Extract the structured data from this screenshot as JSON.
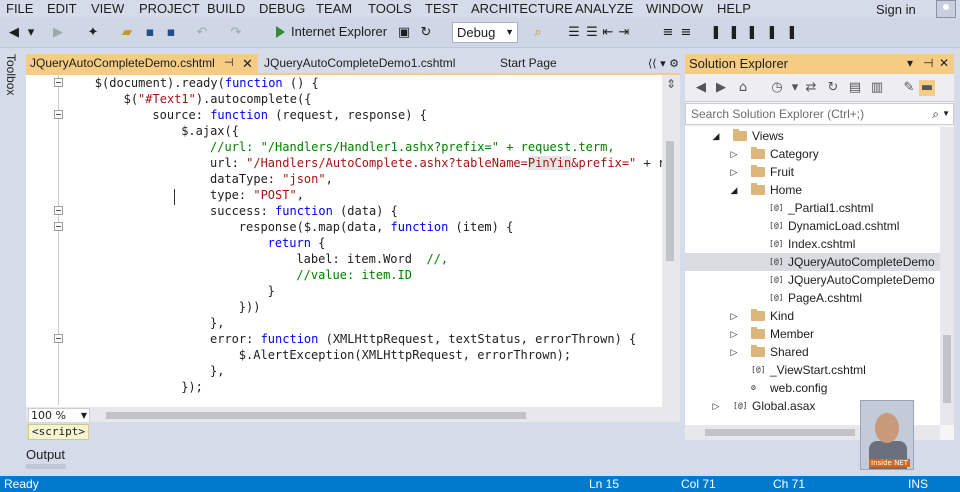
{
  "menu": [
    "FILE",
    "EDIT",
    "VIEW",
    "PROJECT",
    "BUILD",
    "DEBUG",
    "TEAM",
    "TOOLS",
    "TEST",
    "ARCHITECTURE",
    "ANALYZE",
    "WINDOW",
    "HELP"
  ],
  "account": {
    "signin": "Sign in"
  },
  "toolbar": {
    "run_target": "Internet Explorer",
    "configuration": "Debug"
  },
  "toolbox": {
    "label": "Toolbox"
  },
  "tabs": {
    "active": "JQueryAutoCompleteDemo.cshtml",
    "second": "JQueryAutoCompleteDemo1.cshtml",
    "third": "Start Page"
  },
  "code": {
    "lines": [
      {
        "indent": 4,
        "parts": [
          [
            "$(document).ready(",
            ""
          ],
          [
            "function",
            "kw"
          ],
          [
            " () {",
            ""
          ]
        ]
      },
      {
        "indent": 8,
        "parts": [
          [
            "$(",
            ""
          ],
          [
            "\"#Text1\"",
            "str"
          ],
          [
            ").autocomplete({",
            ""
          ]
        ]
      },
      {
        "indent": 12,
        "parts": [
          [
            "source: ",
            ""
          ],
          [
            "function",
            "kw"
          ],
          [
            " (request, response) {",
            ""
          ]
        ]
      },
      {
        "indent": 16,
        "parts": [
          [
            "$.ajax({",
            ""
          ]
        ]
      },
      {
        "indent": 20,
        "parts": [
          [
            "//url: \"/Handlers/Handler1.ashx?prefix=\" + request.term,",
            "cm"
          ]
        ]
      },
      {
        "indent": 20,
        "parts": [
          [
            "url: ",
            ""
          ],
          [
            "\"/Handlers/AutoComplete.ashx?tableName=",
            "str"
          ],
          [
            "PinYin",
            "str hl"
          ],
          [
            "&prefix=\"",
            "str"
          ],
          [
            " + req",
            ""
          ]
        ]
      },
      {
        "indent": 20,
        "parts": [
          [
            "dataType: ",
            ""
          ],
          [
            "\"json\"",
            "str"
          ],
          [
            ",",
            ""
          ]
        ]
      },
      {
        "indent": 20,
        "parts": [
          [
            "type: ",
            ""
          ],
          [
            "\"POST\"",
            "str"
          ],
          [
            ",",
            ""
          ]
        ]
      },
      {
        "indent": 20,
        "parts": [
          [
            "success: ",
            ""
          ],
          [
            "function",
            "kw"
          ],
          [
            " (data) {",
            ""
          ]
        ]
      },
      {
        "indent": 24,
        "parts": [
          [
            "response($.map(data, ",
            ""
          ],
          [
            "function",
            "kw"
          ],
          [
            " (item) {",
            ""
          ]
        ]
      },
      {
        "indent": 28,
        "parts": [
          [
            "return",
            "kw"
          ],
          [
            " {",
            ""
          ]
        ]
      },
      {
        "indent": 32,
        "parts": [
          [
            "label: item.Word  ",
            ""
          ],
          [
            "//,",
            "cm"
          ]
        ]
      },
      {
        "indent": 32,
        "parts": [
          [
            "//value: item.ID",
            "cm"
          ]
        ]
      },
      {
        "indent": 28,
        "parts": [
          [
            "}",
            ""
          ]
        ]
      },
      {
        "indent": 24,
        "parts": [
          [
            "}))",
            ""
          ]
        ]
      },
      {
        "indent": 20,
        "parts": [
          [
            "},",
            ""
          ]
        ]
      },
      {
        "indent": 20,
        "parts": [
          [
            "error: ",
            ""
          ],
          [
            "function",
            "kw"
          ],
          [
            " (XMLHttpRequest, textStatus, errorThrown) {",
            ""
          ]
        ]
      },
      {
        "indent": 24,
        "parts": [
          [
            "$.AlertException(XMLHttpRequest, errorThrown);",
            ""
          ]
        ]
      },
      {
        "indent": 20,
        "parts": [
          [
            "},",
            ""
          ]
        ]
      },
      {
        "indent": 16,
        "parts": [
          [
            "});",
            ""
          ]
        ]
      }
    ]
  },
  "editor": {
    "zoom": "100 %",
    "nav_tag": "<script>"
  },
  "output_tab": "Output",
  "solution_explorer": {
    "title": "Solution Explorer",
    "search_placeholder": "Search Solution Explorer (Ctrl+;)",
    "tree": [
      {
        "label": "Views",
        "type": "folder-open",
        "level": 1,
        "expander": "open"
      },
      {
        "label": "Category",
        "type": "folder",
        "level": 2,
        "expander": "closed"
      },
      {
        "label": "Fruit",
        "type": "folder",
        "level": 2,
        "expander": "closed"
      },
      {
        "label": "Home",
        "type": "folder-open",
        "level": 2,
        "expander": "open"
      },
      {
        "label": "_Partial1.cshtml",
        "type": "file",
        "level": 3,
        "expander": ""
      },
      {
        "label": "DynamicLoad.cshtml",
        "type": "file",
        "level": 3,
        "expander": ""
      },
      {
        "label": "Index.cshtml",
        "type": "file",
        "level": 3,
        "expander": ""
      },
      {
        "label": "JQueryAutoCompleteDemo",
        "type": "file",
        "level": 3,
        "expander": "",
        "selected": true
      },
      {
        "label": "JQueryAutoCompleteDemo",
        "type": "file",
        "level": 3,
        "expander": ""
      },
      {
        "label": "PageA.cshtml",
        "type": "file",
        "level": 3,
        "expander": ""
      },
      {
        "label": "Kind",
        "type": "folder",
        "level": 2,
        "expander": "closed"
      },
      {
        "label": "Member",
        "type": "folder",
        "level": 2,
        "expander": "closed"
      },
      {
        "label": "Shared",
        "type": "folder",
        "level": 2,
        "expander": "closed"
      },
      {
        "label": "_ViewStart.cshtml",
        "type": "file",
        "level": 2,
        "expander": ""
      },
      {
        "label": "web.config",
        "type": "config",
        "level": 2,
        "expander": ""
      },
      {
        "label": "Global.asax",
        "type": "file",
        "level": 1,
        "expander": "closed"
      }
    ]
  },
  "webcam": {
    "watermark": "Inside NET"
  },
  "status": {
    "state": "Ready",
    "line": "Ln 15",
    "col": "Col 71",
    "ch": "Ch 71",
    "mode": "INS"
  },
  "colors": {
    "status_bar": "#007acc",
    "active_tab": "#f5cc84",
    "keyword": "#0000ff",
    "string": "#a31515",
    "comment": "#008000"
  }
}
